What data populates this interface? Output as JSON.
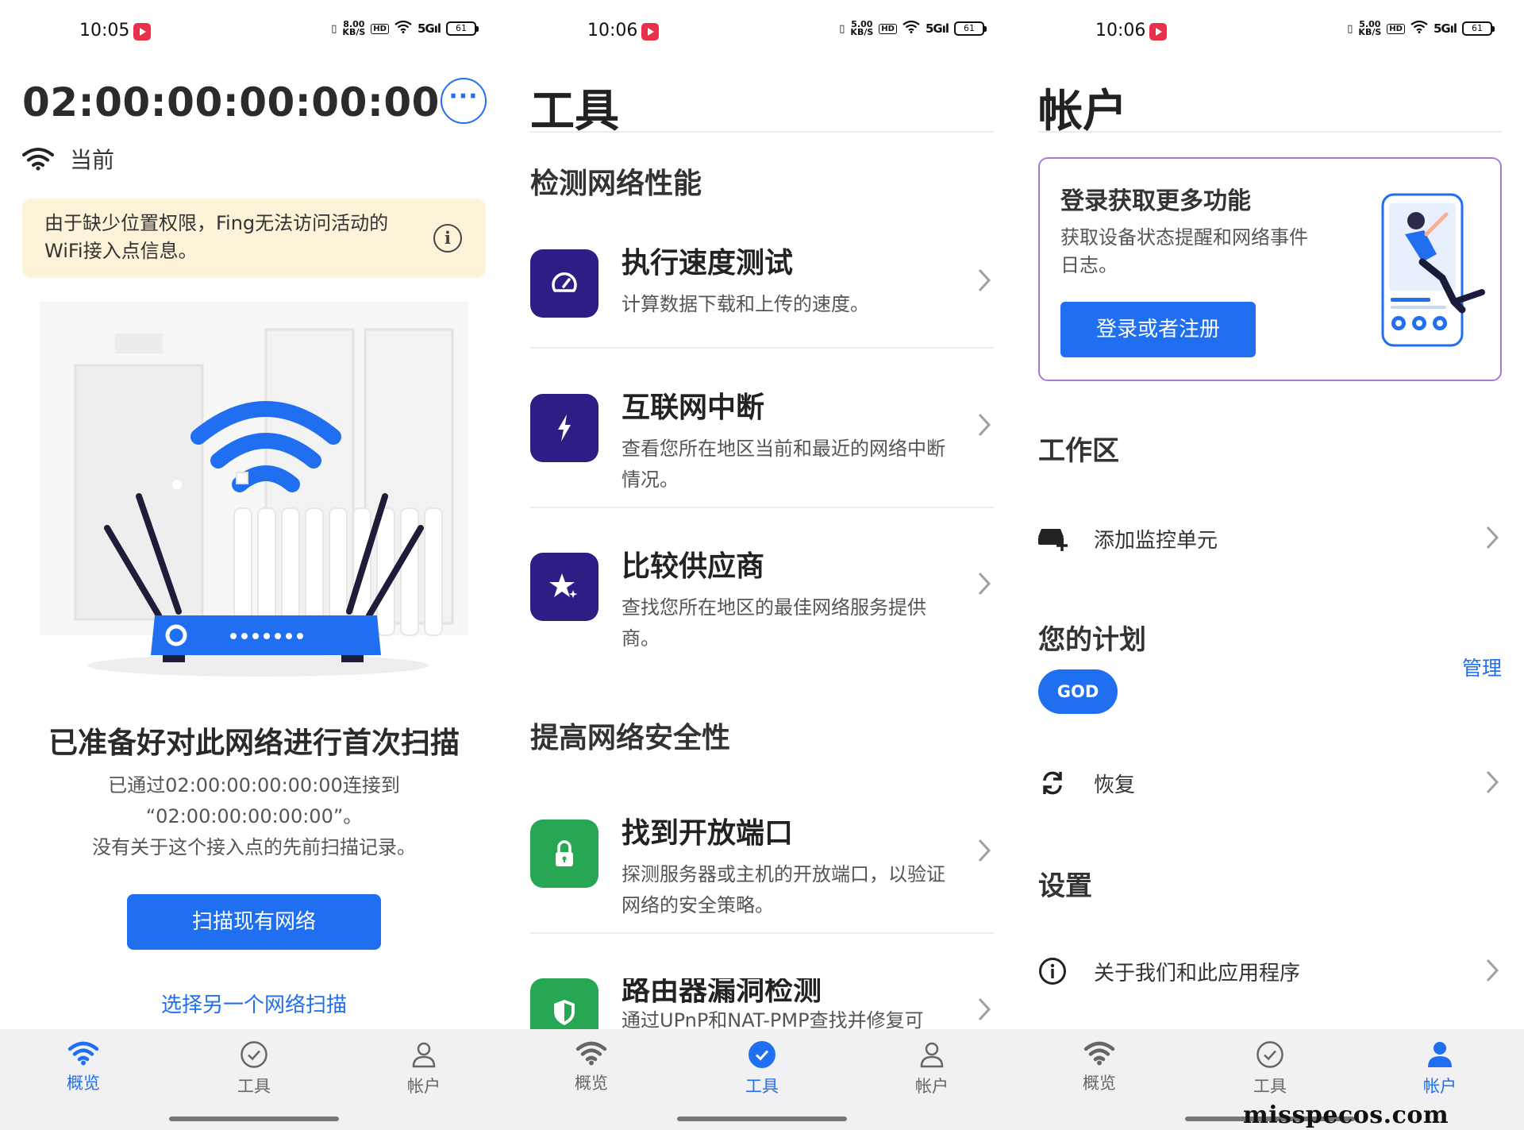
{
  "status1": {
    "time": "10:05",
    "speed": "8.00",
    "speed_unit": "KB/S",
    "hd": "HD",
    "net": "5G",
    "battery": "61"
  },
  "status2": {
    "time": "10:06",
    "speed": "5.00",
    "speed_unit": "KB/S",
    "hd": "HD",
    "net": "5G",
    "battery": "61"
  },
  "status3": {
    "time": "10:06",
    "speed": "5.00",
    "speed_unit": "KB/S",
    "hd": "HD",
    "net": "5G",
    "battery": "61"
  },
  "overview": {
    "mac": "02:00:00:00:00:00",
    "current_label": "当前",
    "warning_line1": "由于缺少位置权限，Fing无法访问活动的",
    "warning_line2": "WiFi接入点信息。",
    "ready_title": "已准备好对此网络进行首次扫描",
    "desc_line1": "已通过02:00:00:00:00:00连接到",
    "desc_line2": "“02:00:00:00:00:00”。",
    "desc_line3": "没有关于这个接入点的先前扫描记录。",
    "scan_button": "扫描现有网络",
    "other_link": "选择另一个网络扫描"
  },
  "tools": {
    "title": "工具",
    "section1": "检测网络性能",
    "section2": "提高网络安全性",
    "items": [
      {
        "title": "执行速度测试",
        "desc": "计算数据下载和上传的速度。"
      },
      {
        "title": "互联网中断",
        "desc": "查看您所在地区当前和最近的网络中断情况。"
      },
      {
        "title": "比较供应商",
        "desc": "查找您所在地区的最佳网络服务提供商。"
      },
      {
        "title": "找到开放端口",
        "desc": "探测服务器或主机的开放端口，以验证网络的安全策略。"
      },
      {
        "title": "路由器漏洞检测",
        "desc": "通过UPnP和NAT-PMP查找并修复可"
      }
    ]
  },
  "account": {
    "title": "帐户",
    "card_title": "登录获取更多功能",
    "card_desc": "获取设备状态提醒和网络事件日志。",
    "card_button": "登录或者注册",
    "workspace": "工作区",
    "add_monitor": "添加监控单元",
    "plan": "您的计划",
    "manage": "管理",
    "plan_badge": "GOD",
    "restore": "恢复",
    "settings": "设置",
    "about": "关于我们和此应用程序"
  },
  "nav": {
    "overview": "概览",
    "tools": "工具",
    "account": "帐户"
  },
  "watermark": "misspecos.com",
  "colors": {
    "accent": "#1f6ff0",
    "tool_icon_purple": "#2d1e85",
    "tool_icon_green": "#27a754",
    "warning_bg": "#fdf3d8",
    "card_border": "#a87bd3"
  }
}
